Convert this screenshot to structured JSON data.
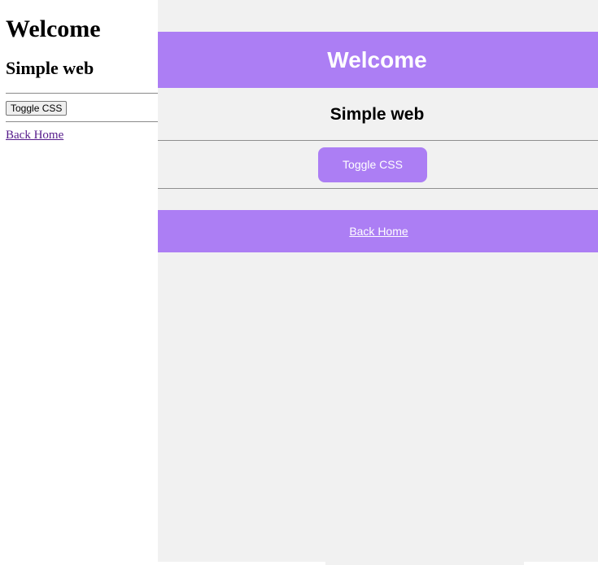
{
  "plain_page": {
    "title": "Welcome",
    "subtitle": "Simple web",
    "toggle_button_label": "Toggle CSS",
    "back_link_label": "Back Home"
  },
  "styled_page": {
    "title": "Welcome",
    "subtitle": "Simple web",
    "toggle_button_label": "Toggle CSS",
    "back_link_label": "Back Home"
  },
  "colors": {
    "accent": "#ac7ef4",
    "styled_background": "#f1f1f1",
    "plain_background": "#ffffff",
    "visited_link": "#551a8b"
  }
}
